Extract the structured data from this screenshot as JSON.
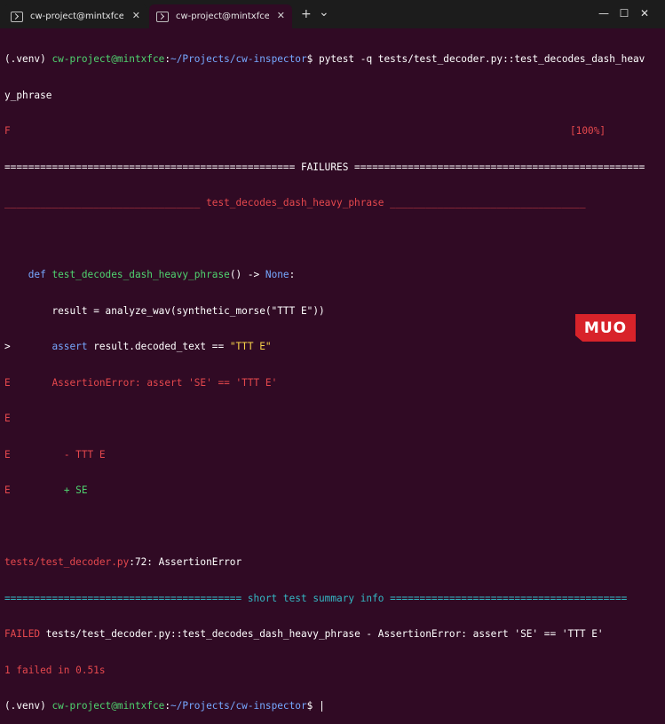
{
  "tabs": [
    {
      "title": "cw-project@mintxfce: ~/Proje",
      "close": "✕"
    },
    {
      "title": "cw-project@mintxfce: ~/Proje",
      "close": "✕"
    }
  ],
  "new_tab": "+",
  "dropdown": "⌄",
  "window": {
    "minimize": "—",
    "maximize": "☐",
    "close": "✕"
  },
  "terminal": {
    "venv": "(.venv) ",
    "user_host": "cw-project@mintxfce",
    "colon": ":",
    "cwd": "~/Projects/cw-inspector",
    "dollar": "$ ",
    "command": "pytest -q tests/test_decoder.py::test_decodes_dash_heav",
    "command_cont": "y_phrase",
    "status_f": "F",
    "percent": "[100%]",
    "failures_rule": "================================================= FAILURES =================================================",
    "test_rule": "_________________________________ test_decodes_dash_heavy_phrase _________________________________",
    "def_kw": "def ",
    "def_name": "test_decodes_dash_heavy_phrase",
    "def_tail": "() -> ",
    "none_kw": "None",
    "def_colon": ":",
    "result_line": "result = analyze_wav(synthetic_morse(\"TTT E\"))",
    "marker_arrow": ">",
    "assert_kw": "assert",
    "assert_mid": " result.decoded_text == ",
    "assert_str": "\"TTT E\"",
    "marker_e": "E",
    "assertion_error": "AssertionError: assert 'SE' == 'TTT E'",
    "diff_minus": "- TTT E",
    "diff_plus": "+ SE",
    "location_file": "tests/test_decoder.py",
    "location_tail": ":72: AssertionError",
    "summary_rule_left": "======================================== ",
    "summary_title": "short test summary info",
    "summary_rule_right": " ========================================",
    "failed_label": "FAILED",
    "failed_detail": " tests/test_decoder.py::test_decodes_dash_heavy_phrase - AssertionError: assert 'SE' == 'TTT E'",
    "failed_count": "1 failed in 0.51s"
  },
  "watermark": "MUO"
}
